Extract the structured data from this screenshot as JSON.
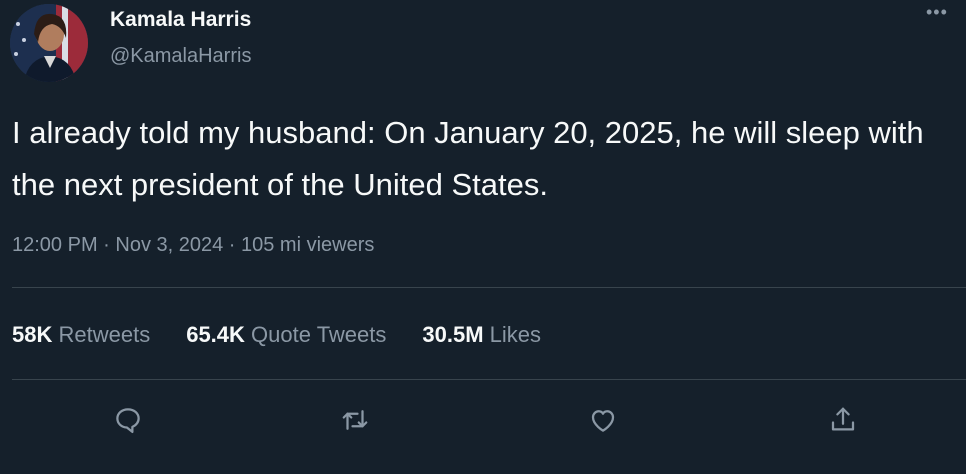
{
  "author": {
    "name": "Kamala Harris",
    "handle": "@KamalaHarris"
  },
  "more_glyph": "•••",
  "tweet": {
    "text": "I already told my husband: On January 20, 2025, he will sleep with the next president of the United States.",
    "meta": "12:00 PM · Nov 3, 2024 · 105 mi viewers"
  },
  "stats": [
    {
      "count": "58K",
      "label": "Retweets"
    },
    {
      "count": "65.4K",
      "label": "Quote Tweets"
    },
    {
      "count": "30.5M",
      "label": "Likes"
    }
  ],
  "actions": [
    "reply-icon",
    "retweet-icon",
    "like-icon",
    "share-icon"
  ],
  "colors": {
    "background": "#15202b",
    "text_primary": "#f7f9f9",
    "text_secondary": "#8b98a5",
    "divider": "#38444d"
  }
}
